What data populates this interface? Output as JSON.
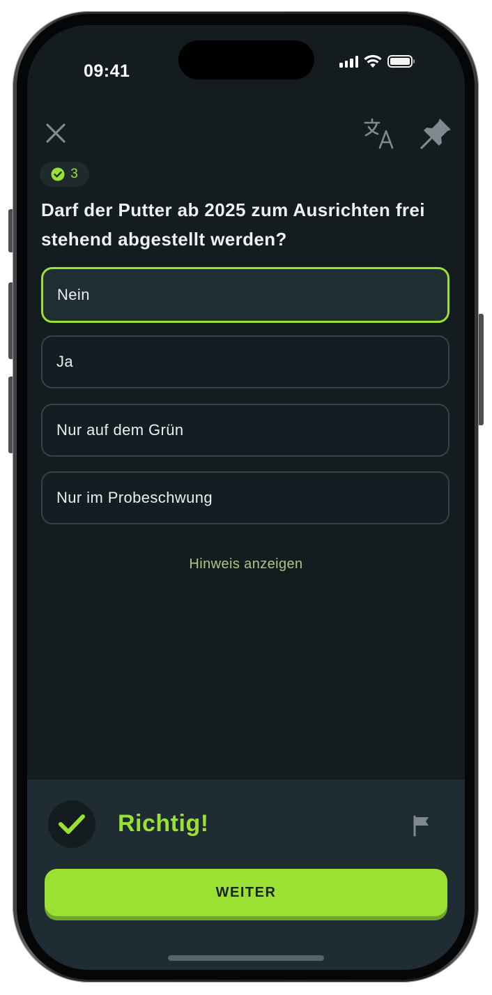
{
  "status_bar": {
    "time": "09:41"
  },
  "top_bar": {
    "close_icon": "close-icon",
    "translate_icon": "translate-icon",
    "pin_icon": "pin-icon"
  },
  "streak": {
    "icon": "check-circle-icon",
    "count": "3"
  },
  "question": "Darf der Putter ab 2025 zum Ausrichten frei stehend abgestellt werden?",
  "answers": [
    {
      "label": "Nein",
      "selected": true
    },
    {
      "label": "Ja",
      "selected": false
    },
    {
      "label": "Nur auf dem Grün",
      "selected": false
    },
    {
      "label": "Nur im Probeschwung",
      "selected": false
    }
  ],
  "hint_label": "Hinweis anzeigen",
  "feedback": {
    "result": "Richtig!",
    "result_icon": "checkmark-icon",
    "report_icon": "flag-icon",
    "continue_label": "WEITER"
  },
  "colors": {
    "accent": "#9be133",
    "background": "#141c20",
    "panel": "#1f2c33",
    "hint": "#a8c68a"
  }
}
